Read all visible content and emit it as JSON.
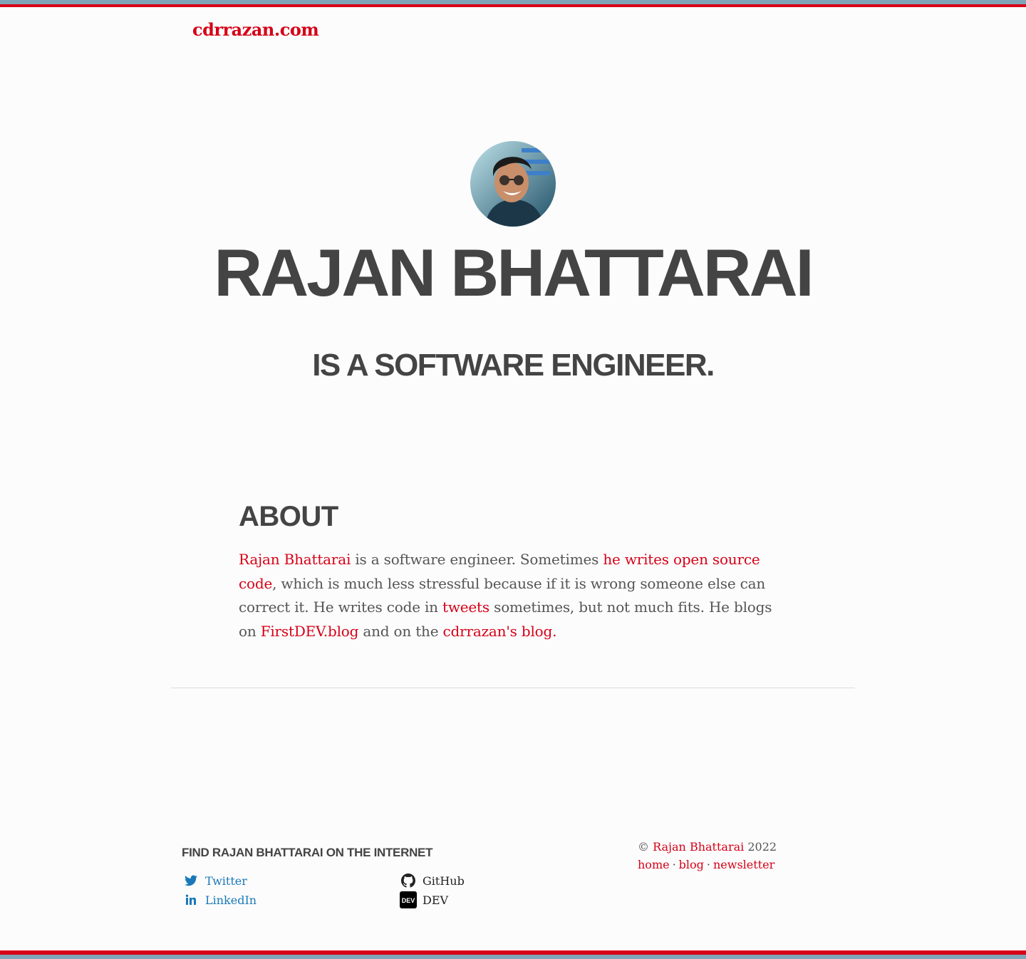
{
  "header": {
    "site_title": "cdrrazan.com"
  },
  "hero": {
    "name": "RAJAN BHATTARAI",
    "subtitle": "IS A SOFTWARE ENGINEER."
  },
  "about": {
    "heading": "ABOUT",
    "name_link": "Rajan Bhattarai",
    "text_1": " is a software engineer. Sometimes ",
    "oss_link": "he writes open source code",
    "text_2": ", which is much less stressful because if it is wrong someone else can correct it. He writes code in ",
    "tweets_link": "tweets",
    "text_3": " sometimes, but not much fits. He blogs on ",
    "firstdev_link": "FirstDEV.blog",
    "text_4": " and on the ",
    "blog_link": "cdrrazan's blog.",
    "text_5": ""
  },
  "footer": {
    "find_heading": "FIND RAJAN BHATTARAI ON THE INTERNET",
    "links": [
      {
        "label": "Twitter",
        "icon": "twitter-icon"
      },
      {
        "label": "GitHub",
        "icon": "github-icon"
      },
      {
        "label": "LinkedIn",
        "icon": "linkedin-icon"
      },
      {
        "label": "DEV",
        "icon": "dev-icon"
      }
    ],
    "copyright_symbol": "©",
    "copyright_name": "Rajan Bhattarai",
    "copyright_year": "2022",
    "nav": [
      "home",
      "blog",
      "newsletter"
    ],
    "separator": "·"
  },
  "colors": {
    "accent": "#d60017",
    "top_stripe": "#7fa6b8",
    "link_blue": "#1a78b8",
    "heading": "#444444"
  }
}
